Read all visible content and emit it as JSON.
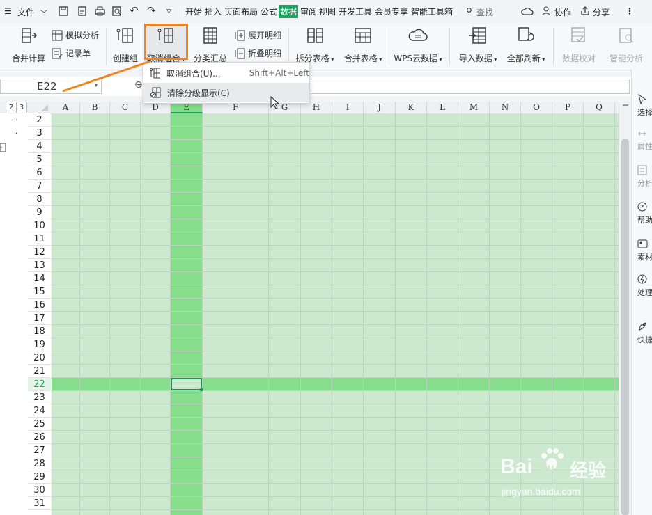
{
  "title_bar": {
    "file_label": "文件",
    "menu_tabs": [
      "开始",
      "插入",
      "页面布局",
      "公式",
      "数据",
      "审阅",
      "视图",
      "开发工具",
      "会员专享",
      "智能工具箱"
    ],
    "active_tab": "数据",
    "search_label": "查找",
    "collab_label": "协作",
    "share_label": "分享"
  },
  "ribbon": {
    "merge_calc": "合并计算",
    "simulate": "模拟分析",
    "record_form": "记录单",
    "create_group": "创建组",
    "ungroup": "取消组合",
    "subtotal": "分类汇总",
    "expand_detail": "展开明细",
    "collapse_detail": "折叠明细",
    "split_table": "拆分表格",
    "merge_table": "合并表格",
    "wps_cloud": "WPS云数据",
    "import_data": "导入数据",
    "refresh_all": "全部刷新",
    "data_check": "数据校对",
    "smart_analysis": "智能分析"
  },
  "name_box": "E22",
  "outline_levels": [
    "2",
    "3"
  ],
  "dropdown": {
    "items": [
      {
        "label": "取消组合(U)...",
        "shortcut": "Shift+Alt+Left"
      },
      {
        "label": "清除分级显示(C)",
        "shortcut": ""
      }
    ]
  },
  "columns": [
    "A",
    "B",
    "C",
    "D",
    "E",
    "F",
    "G",
    "H",
    "I",
    "J",
    "K",
    "L",
    "M",
    "N",
    "O",
    "P",
    "Q"
  ],
  "rows": [
    "2",
    "3",
    "4",
    "5",
    "6",
    "7",
    "8",
    "9",
    "10",
    "11",
    "12",
    "13",
    "14",
    "15",
    "16",
    "17",
    "18",
    "19",
    "20",
    "21",
    "22",
    "23",
    "24",
    "25",
    "26",
    "27",
    "28",
    "29",
    "30",
    "31"
  ],
  "selected_cell": {
    "column": "E",
    "row": "22"
  },
  "right_panel": [
    "选择",
    "属性",
    "分析",
    "帮助",
    "素材",
    "处理",
    "快捷"
  ],
  "watermark": {
    "brand": "Bai",
    "brand2": "du",
    "cn": "经验",
    "url": "jingyan.baidu.com"
  },
  "colors": {
    "accent": "#1fa362",
    "sheet_bg": "#cce8cf",
    "highlight": "#86dd8b",
    "callout": "#f0851f"
  }
}
